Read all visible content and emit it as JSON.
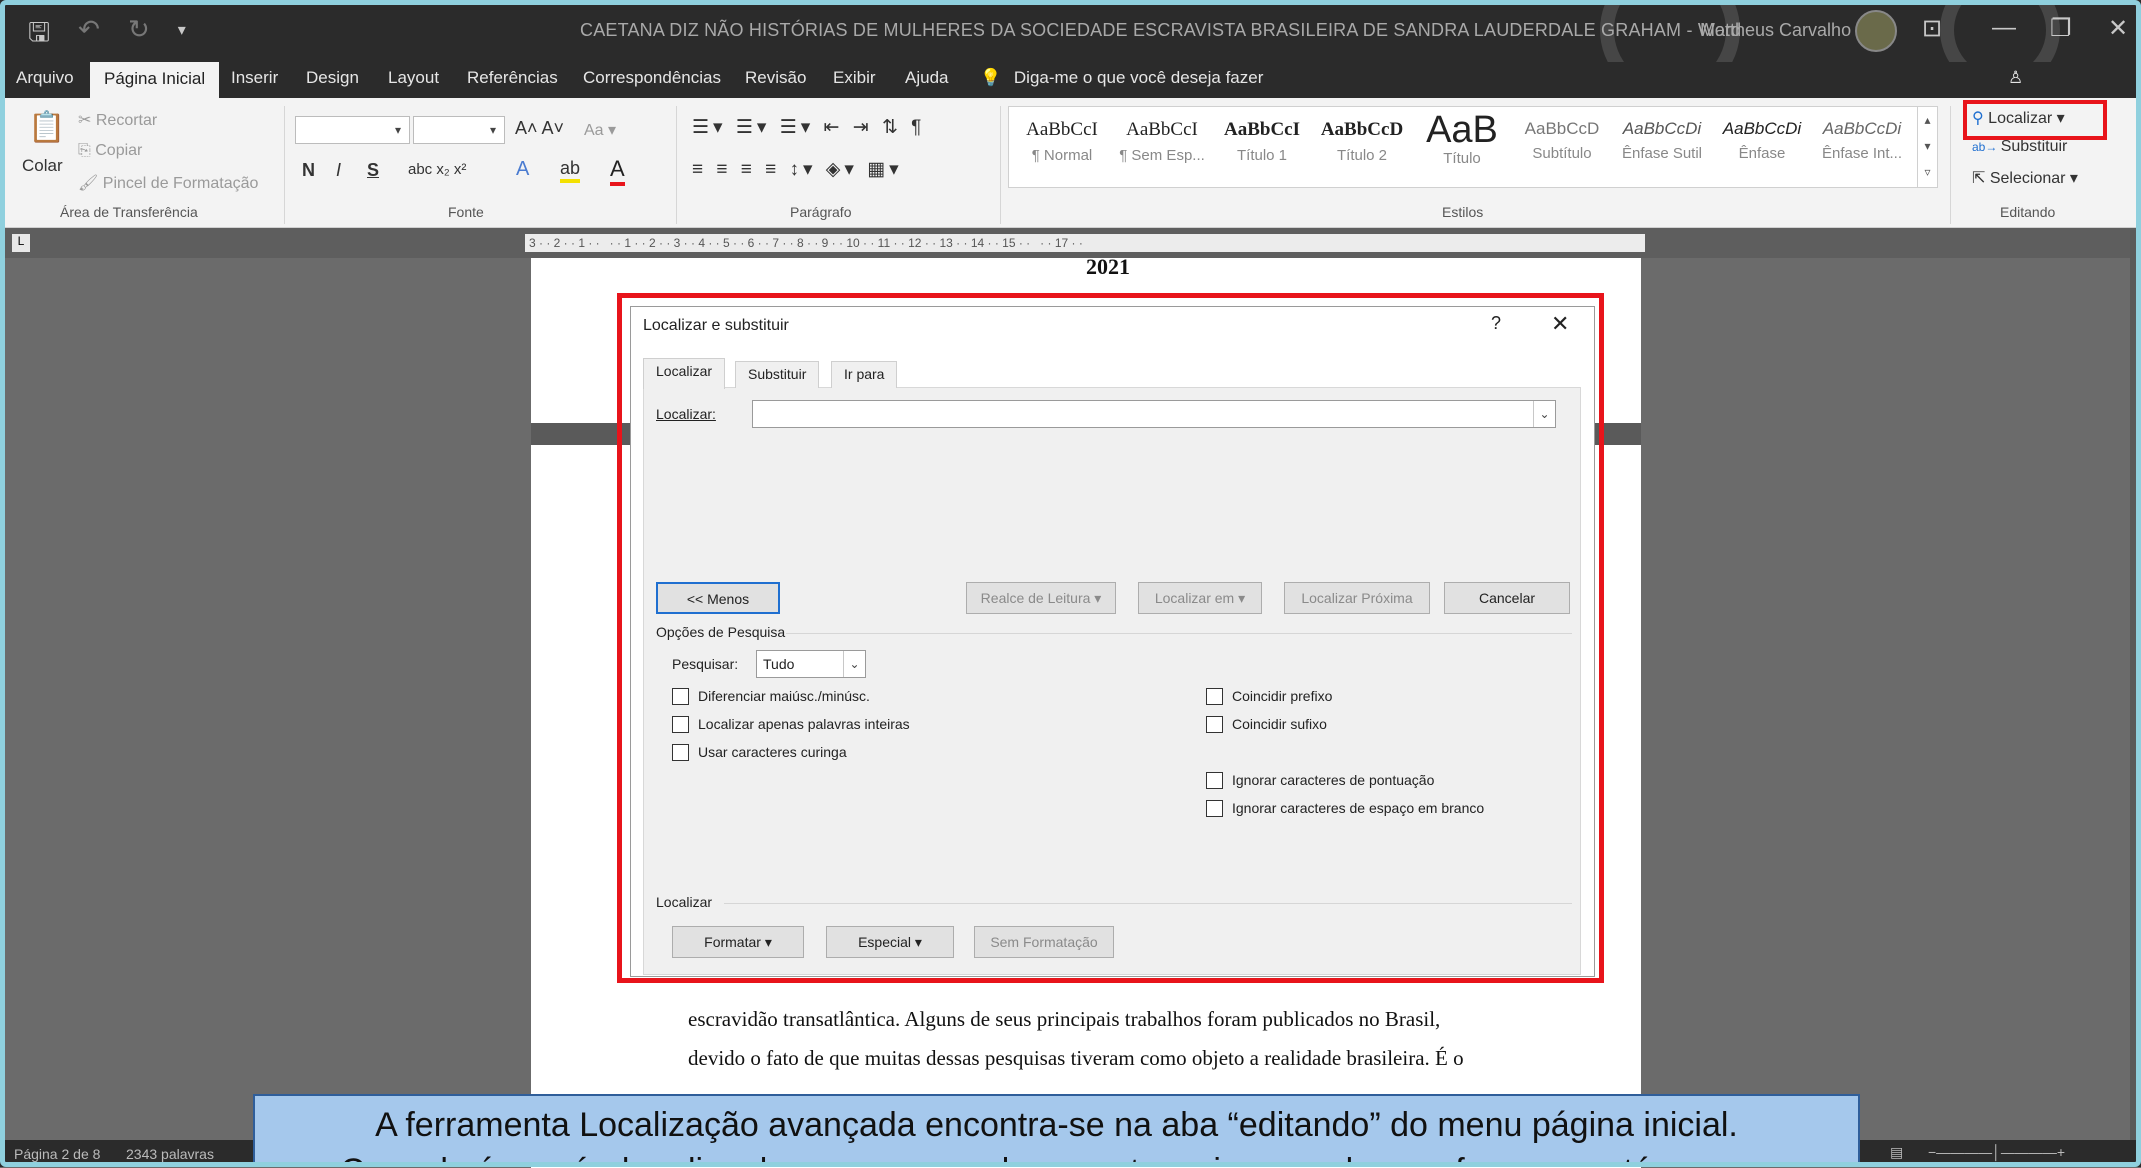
{
  "titlebar": {
    "doc_title": "CAETANA DIZ NÃO HISTÓRIAS DE MULHERES DA SOCIEDADE ESCRAVISTA BRASILEIRA DE SANDRA LAUDERDALE GRAHAM  -  Word",
    "user": "Mattheus Carvalho",
    "qat_save_icon": "save-icon",
    "qat_undo_icon": "undo-icon",
    "qat_redo_icon": "redo-icon"
  },
  "menu": {
    "items": [
      "Arquivo",
      "Página Inicial",
      "Inserir",
      "Design",
      "Layout",
      "Referências",
      "Correspondências",
      "Revisão",
      "Exibir",
      "Ajuda"
    ],
    "tell_me": "Diga-me o que você deseja fazer"
  },
  "ribbon": {
    "clipboard": {
      "paste": "Colar",
      "cut": "Recortar",
      "copy": "Copiar",
      "format_painter": "Pincel de Formatação",
      "label": "Área de Transferência"
    },
    "font": {
      "label": "Fonte",
      "bold": "N",
      "italic": "I",
      "underline": "S"
    },
    "paragraph": {
      "label": "Parágrafo"
    },
    "styles": {
      "label": "Estilos",
      "items": [
        {
          "sample": "AaBbCcI",
          "name": "¶ Normal"
        },
        {
          "sample": "AaBbCcI",
          "name": "¶ Sem Esp..."
        },
        {
          "sample": "AaBbCcI",
          "name": "Título 1"
        },
        {
          "sample": "AaBbCcD",
          "name": "Título 2"
        },
        {
          "sample": "AaB",
          "name": "Título"
        },
        {
          "sample": "AaBbCcD",
          "name": "Subtítulo"
        },
        {
          "sample": "AaBbCcDi",
          "name": "Ênfase Sutil"
        },
        {
          "sample": "AaBbCcDi",
          "name": "Ênfase"
        },
        {
          "sample": "AaBbCcDi",
          "name": "Ênfase Int..."
        }
      ]
    },
    "editing": {
      "find": "Localizar",
      "replace": "Substituir",
      "select": "Selecionar",
      "label": "Editando"
    }
  },
  "ruler": {
    "text": "3 · · 2 · · 1 · ·   · · 1 · · 2 · · 3 · · 4 · · 5 · · 6 · · 7 · · 8 · · 9 · · 10 · · 11 · · 12 · · 13 · · 14 · · 15 · ·   · · 17 · ·"
  },
  "document": {
    "year": "2021",
    "line1": "escravidão transatlântica. Alguns de seus principais trabalhos foram publicados no Brasil,",
    "line2": "devido o fato de que muitas dessas pesquisas tiveram como objeto a realidade brasileira. É o"
  },
  "dialog": {
    "title": "Localizar e substituir",
    "help": "?",
    "tabs": [
      "Localizar",
      "Substituir",
      "Ir para"
    ],
    "find_label": "Localizar:",
    "find_value": "",
    "buttons": {
      "less": "<< Menos",
      "reading_highlight": "Realce de Leitura ▾",
      "find_in": "Localizar em ▾",
      "find_next": "Localizar Próxima",
      "cancel": "Cancelar"
    },
    "search_options_label": "Opções de Pesquisa",
    "search_label": "Pesquisar:",
    "search_value": "Tudo",
    "left_options": [
      "Diferenciar maiúsc./minúsc.",
      "Localizar apenas palavras inteiras",
      "Usar caracteres curinga"
    ],
    "right_options_top": [
      "Coincidir prefixo",
      "Coincidir sufixo"
    ],
    "right_options_bottom": [
      "Ignorar caracteres de pontuação",
      "Ignorar caracteres de espaço em branco"
    ],
    "find_section_label": "Localizar",
    "format_button": "Formatar ▾",
    "special_button": "Especial ▾",
    "no_format_button": "Sem Formatação"
  },
  "statusbar": {
    "page": "Página 2 de 8",
    "words": "2343 palavras"
  },
  "caption": {
    "line1": "A ferramenta Localização avançada encontra-se na aba “editando” do menu página inicial.",
    "line2": "Com ela é possível realizar buscas em um documento, seja por palavras, frases ou até mesmo"
  },
  "colors": {
    "highlight": "#e8141b",
    "caption_bg": "#a5c8ec",
    "titlebar": "#2b2b2b"
  }
}
